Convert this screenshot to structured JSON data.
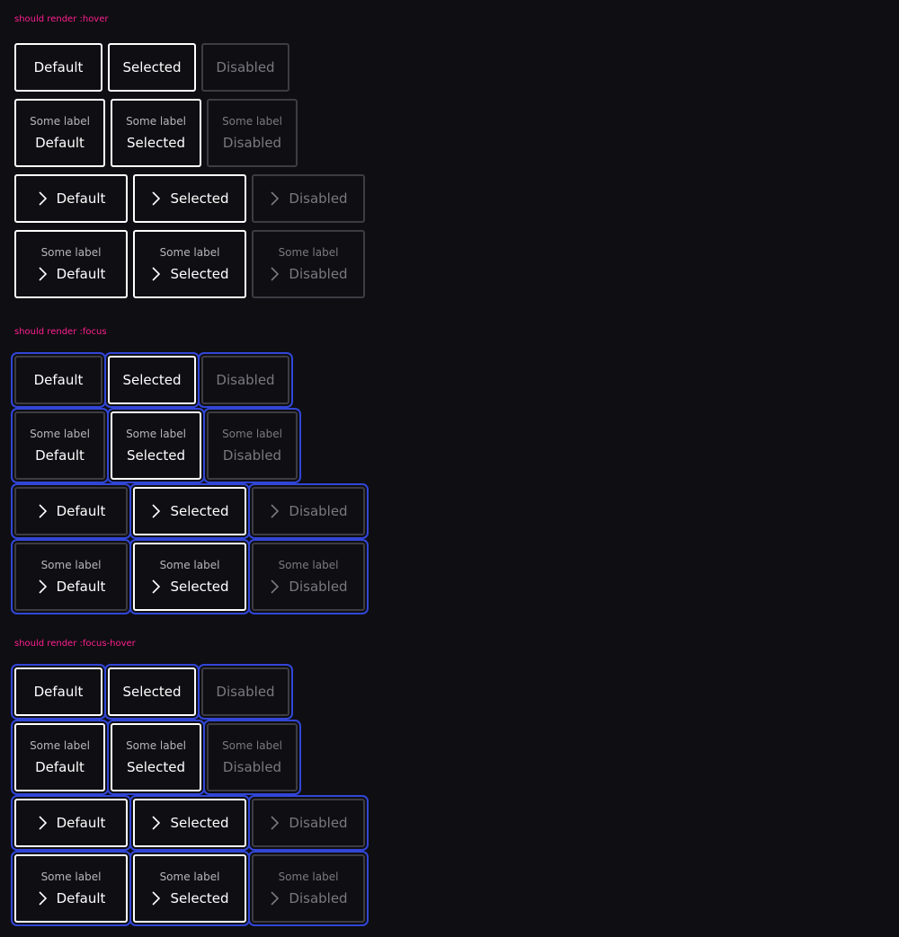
{
  "sections": [
    {
      "id": "hover",
      "title": "should render :hover"
    },
    {
      "id": "focus",
      "title": "should render :focus"
    },
    {
      "id": "focus-hover",
      "title": "should render :focus-hover"
    }
  ],
  "labels": {
    "default": "Default",
    "selected": "Selected",
    "disabled": "Disabled",
    "sub": "Some label"
  },
  "icons": {
    "chevron": "chevron-right-icon"
  },
  "colors": {
    "background": "#0f0e13",
    "title": "#ff1f8f",
    "border": "#ffffff",
    "disabled_border": "#3d3c42",
    "disabled_text": "#7a7980",
    "focus_ring": "#3146d6"
  }
}
